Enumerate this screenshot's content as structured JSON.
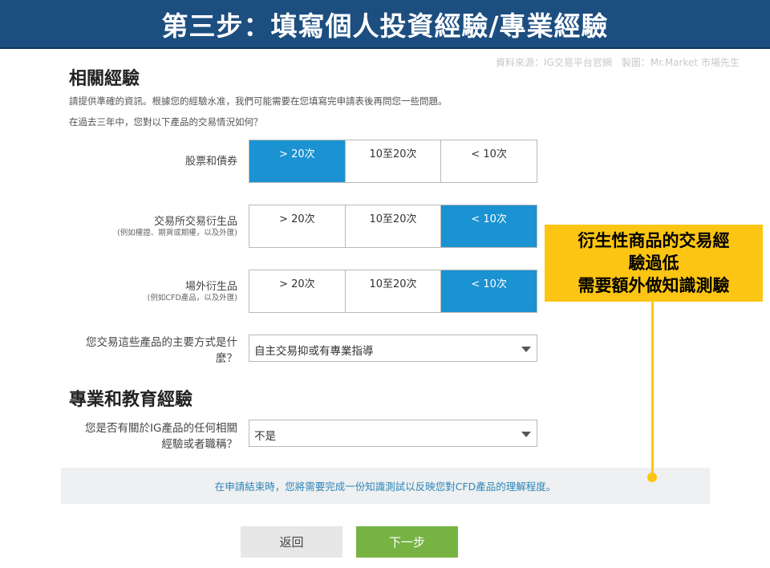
{
  "banner": {
    "title": "第三步：填寫個人投資經驗/專業經驗"
  },
  "source_note": "資料來源：IG交易平台官網　製圖：Mr.Market 市場先生",
  "experience": {
    "heading": "相關經驗",
    "intro_1": "請提供準確的資訊。根據您的經驗水准，我們可能需要在您填寫完申請表後再問您一些問題。",
    "intro_2": "在過去三年中，您對以下產品的交易情況如何？",
    "rows": [
      {
        "label": "股票和債券",
        "note": "",
        "options": [
          "> 20次",
          "10至20次",
          "< 10次"
        ],
        "selected": "> 20次"
      },
      {
        "label": "交易所交易衍生品",
        "note": "(例如權證、期貨或期權，以及外匯)",
        "options": [
          "> 20次",
          "10至20次",
          "< 10次"
        ],
        "selected": "< 10次"
      },
      {
        "label": "場外衍生品",
        "note": "(例如CFD產品，以及外匯)",
        "options": [
          "> 20次",
          "10至20次",
          "< 10次"
        ],
        "selected": "< 10次"
      }
    ],
    "method_question_line1": "您交易這些產品的主要方式是什",
    "method_question_line2": "麼？",
    "method_value": "自主交易抑或有專業指導"
  },
  "professional": {
    "heading": "專業和教育經驗",
    "question_line1": "您是否有關於IG產品的任何相關",
    "question_line2": "經驗或者職稱？",
    "value": "不是"
  },
  "notice": "在申請結束時，您將需要完成一份知識測試以反映您對CFD產品的理解程度。",
  "buttons": {
    "back": "返回",
    "next": "下一步"
  },
  "callout": {
    "line1": "衍生性商品的交易經",
    "line2": "驗過低",
    "line3": "需要額外做知識測驗"
  },
  "colors": {
    "banner": "#1c4e80",
    "selected": "#1b92d1",
    "next_button": "#76b343",
    "callout": "#fcc513",
    "notice_text": "#2f86b8"
  }
}
